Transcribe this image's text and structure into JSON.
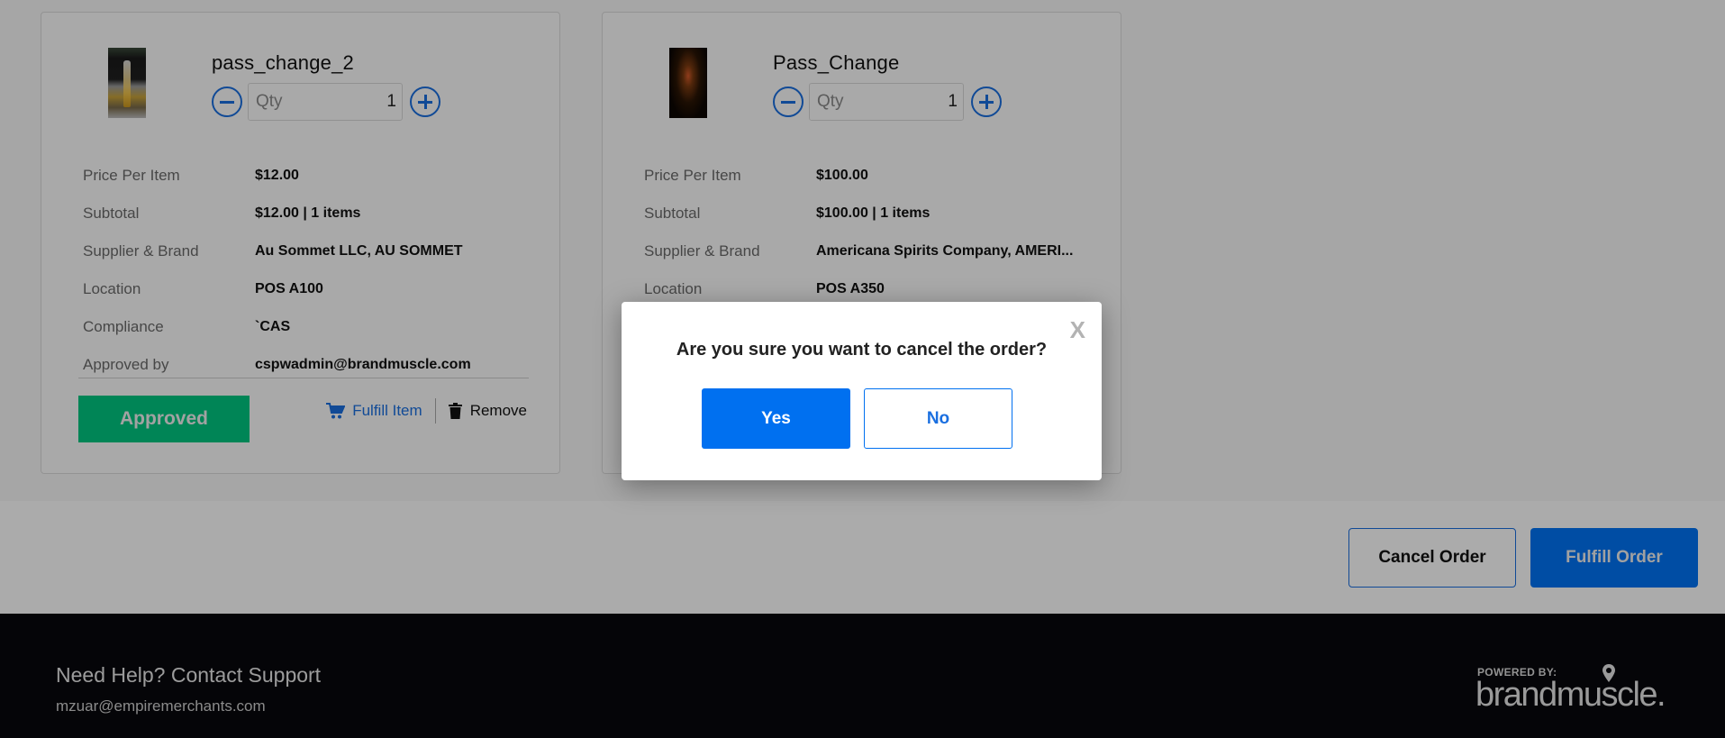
{
  "items": [
    {
      "title": "pass_change_2",
      "image": "bottle-photo",
      "qty_placeholder": "Qty",
      "qty_value": "1",
      "fields": [
        {
          "label": "Price Per Item",
          "value": "$12.00"
        },
        {
          "label": "Subtotal",
          "value": "$12.00 | 1 items"
        },
        {
          "label": "Supplier & Brand",
          "value": "Au Sommet LLC, AU SOMMET"
        },
        {
          "label": "Location",
          "value": "POS A100"
        },
        {
          "label": "Compliance",
          "value": "`CAS"
        },
        {
          "label": "Approved by",
          "value": "cspwadmin@brandmuscle.com"
        }
      ],
      "status": "Approved",
      "fulfill_label": "Fulfill Item",
      "remove_label": "Remove"
    },
    {
      "title": "Pass_Change",
      "image": "glass-photo",
      "qty_placeholder": "Qty",
      "qty_value": "1",
      "fields": [
        {
          "label": "Price Per Item",
          "value": "$100.00"
        },
        {
          "label": "Subtotal",
          "value": "$100.00 | 1 items"
        },
        {
          "label": "Supplier & Brand",
          "value": "Americana Spirits Company, AMERI..."
        },
        {
          "label": "Location",
          "value": "POS A350"
        }
      ]
    }
  ],
  "order_actions": {
    "cancel_label": "Cancel Order",
    "fulfill_label": "Fulfill Order"
  },
  "footer": {
    "help_title": "Need Help? Contact Support",
    "help_email": "mzuar@empiremerchants.com",
    "powered_by": "POWERED BY:",
    "brand": "brandmuscle."
  },
  "modal": {
    "close_label": "X",
    "message": "Are you sure you want to cancel the order?",
    "yes_label": "Yes",
    "no_label": "No"
  },
  "colors": {
    "primary_blue": "#0070f0",
    "approved_green": "#00c781",
    "footer_bg": "#08080c"
  }
}
